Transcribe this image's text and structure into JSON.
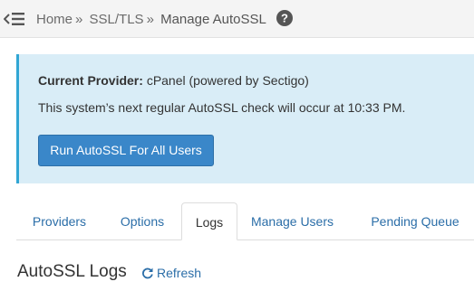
{
  "breadcrumb": {
    "items": [
      "Home",
      "SSL/TLS"
    ],
    "separator": "»",
    "current": "Manage AutoSSL"
  },
  "notice": {
    "provider_label": "Current Provider:",
    "provider_value": "cPanel (powered by Sectigo)",
    "schedule_text": "This system’s next regular AutoSSL check will occur at 10:33 PM.",
    "button_label": "Run AutoSSL For All Users"
  },
  "tabs": [
    {
      "label": "Providers",
      "active": false
    },
    {
      "label": "Options",
      "active": false
    },
    {
      "label": "Logs",
      "active": true
    },
    {
      "label": "Manage Users",
      "active": false
    },
    {
      "label": "Pending Queue",
      "active": false
    }
  ],
  "logs": {
    "title": "AutoSSL Logs",
    "refresh_label": "Refresh"
  },
  "icons": {
    "menu": "menu-collapse-icon",
    "help": "question-circle-icon",
    "refresh": "refresh-icon"
  },
  "colors": {
    "link": "#2b6ea8",
    "button": "#3a87c9",
    "notice_bg": "#d9edf7",
    "notice_border": "#31a6d4"
  }
}
